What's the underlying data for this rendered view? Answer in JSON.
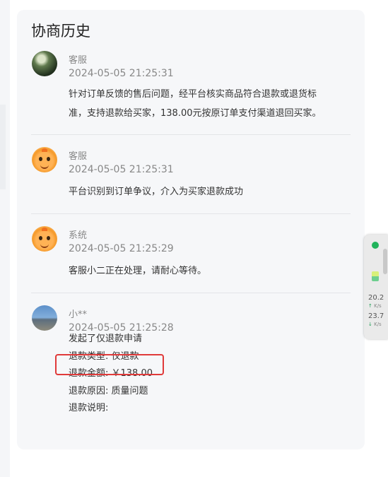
{
  "title": "协商历史",
  "entries": [
    {
      "role": "客服",
      "time": "2024-05-05 21:25:31",
      "avatar": "photo-avatar",
      "lines": [
        "针对订单反馈的售后问题，经平台核实商品符合退款或退货标",
        "准，支持退款给买家，138.00元按原订单支付渠道退回买家。"
      ]
    },
    {
      "role": "客服",
      "time": "2024-05-05 21:25:31",
      "avatar": "orange-mascot-avatar",
      "lines": [
        "平台识别到订单争议，介入为买家退款成功"
      ]
    },
    {
      "role": "系统",
      "time": "2024-05-05 21:25:29",
      "avatar": "orange-mascot-avatar",
      "lines": [
        "客服小二正在处理，请耐心等待。"
      ]
    },
    {
      "role": "小**",
      "time": "2024-05-05 21:25:28",
      "avatar": "landscape-avatar",
      "lines": [
        "发起了仅退款申请",
        "退款类型: 仅退款",
        "退款金额: ￥138.00",
        "退款原因: 质量问题",
        "退款说明:"
      ]
    }
  ],
  "widget": {
    "upload_speed": "20.2",
    "upload_unit": "K/s",
    "download_speed": "23.7",
    "download_unit": "K/s",
    "status_color": "#21b35b"
  },
  "colors": {
    "card_bg": "#f6f7f9",
    "highlight": "#e03a3a",
    "muted_text": "#888888"
  }
}
